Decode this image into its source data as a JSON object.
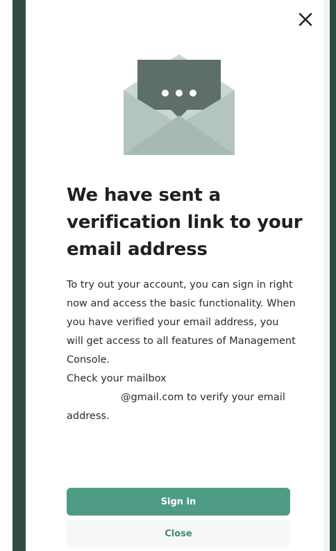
{
  "dialog": {
    "close_icon": "close-icon",
    "illustration_icon": "envelope-message-icon",
    "title": "We have sent a verification link to your email address",
    "body": [
      "To try out your account, you can sign in right now and access the basic functionality. When you have verified your email address, you will get access to all features of Management Console.",
      "Check your mailbox"
    ],
    "email_suffix": "@gmail.com to verify your email address.",
    "sign_in_label": "Sign in",
    "close_label": "Close"
  },
  "colors": {
    "side_panel": "#2f4d44",
    "primary_button": "#4f9c86",
    "secondary_button_bg": "#f6f8f8",
    "secondary_button_text": "#3f8a74",
    "envelope_light": "#c9d6d3",
    "envelope_dark": "#5e6e6b"
  }
}
